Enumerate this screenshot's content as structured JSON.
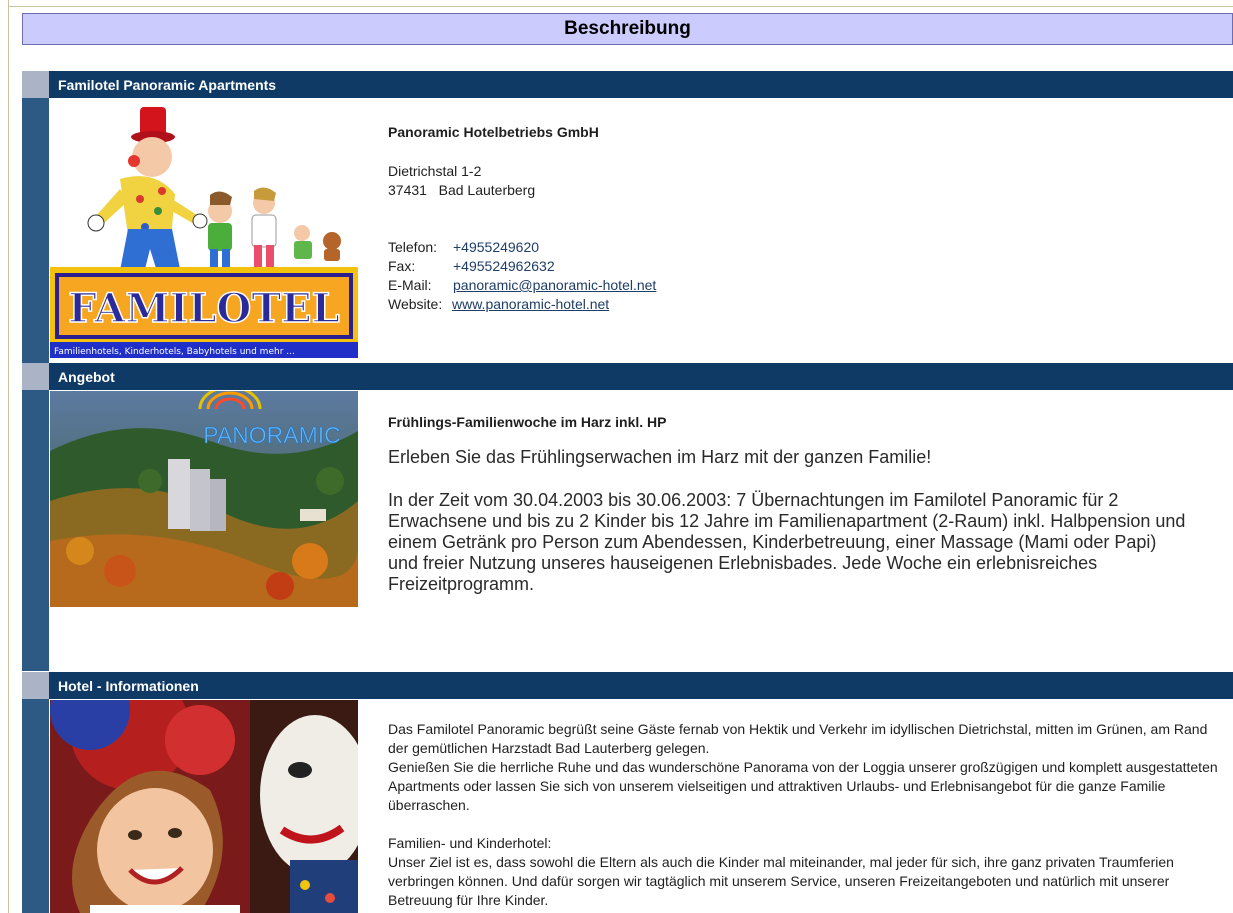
{
  "page_title": "Beschreibung",
  "sections": {
    "contact": {
      "title": "Familotel Panoramic Apartments",
      "logo_word": "FAMILOTEL",
      "logo_tagline": "Familienhotels, Kinderhotels, Babyhotels und mehr ...",
      "company": "Panoramic Hotelbetriebs GmbH",
      "street": "Dietrichstal 1-2",
      "zip": "37431",
      "city": "Bad Lauterberg",
      "phone_label": "Telefon:",
      "phone": "+4955249620",
      "fax_label": "Fax:",
      "fax": "+495524962632",
      "email_label": "E-Mail:",
      "email": "panoramic@panoramic-hotel.net",
      "website_label": "Website:",
      "website": "www.panoramic-hotel.net"
    },
    "offer": {
      "title": "Angebot",
      "image_logo_word": "PANORAMIC",
      "heading": "Frühlings-Familienwoche im Harz inkl. HP",
      "intro": "Erleben Sie das Frühlingserwachen im Harz mit der ganzen Familie!",
      "body": "In der Zeit vom 30.04.2003 bis 30.06.2003: 7 Übernachtungen im Familotel Panoramic für 2 Erwachsene und bis zu 2 Kinder bis 12 Jahre im Familienapartment (2-Raum) inkl. Halbpension und einem Getränk pro Person zum Abendessen, Kinderbetreuung, einer Massage (Mami oder Papi) und freier Nutzung unseres hauseigenen Erlebnisbades. Jede Woche ein erlebnisreiches Freizeitprogramm."
    },
    "info": {
      "title": "Hotel - Informationen",
      "p1": "Das Familotel Panoramic begrüßt seine Gäste fernab von Hektik und Verkehr im idyllischen Dietrichstal, mitten im Grünen, am Rand der gemütlichen Harzstadt Bad Lauterberg gelegen.",
      "p2": "Genießen Sie die herrliche Ruhe und das wunderschöne Panorama von der Loggia unserer großzügigen und komplett ausgestatteten Apartments oder lassen Sie sich von unserem vielseitigen und attraktiven Urlaubs- und Erlebnisangebot für die ganze Familie überraschen.",
      "p3": "Familien- und Kinderhotel:",
      "p4": "Unser Ziel ist es, dass sowohl die Eltern als auch die Kinder mal miteinander, mal jeder für sich, ihre ganz privaten Traumferien verbringen können. Und dafür sorgen wir tagtäglich mit unserem Service, unseren Freizeitangeboten und natürlich mit unserer Betreuung für Ihre Kinder."
    }
  }
}
